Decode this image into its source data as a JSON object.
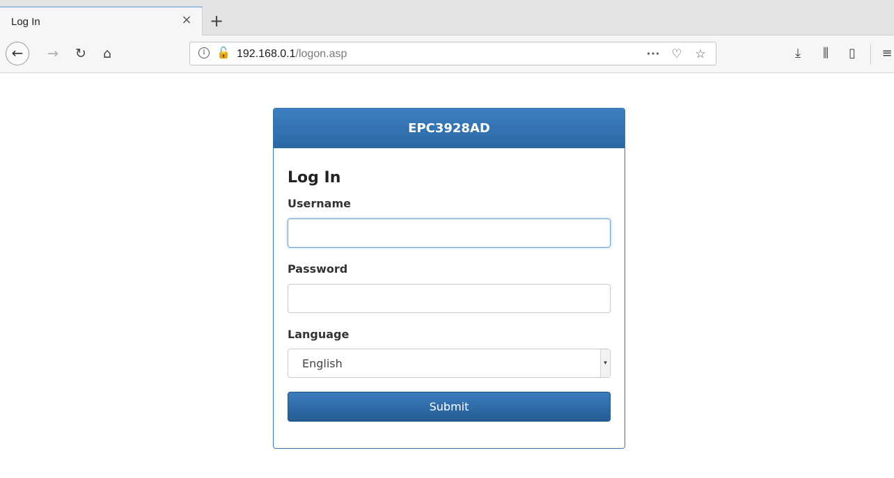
{
  "browser": {
    "tab": {
      "title": "Log In",
      "close_glyph": "×"
    },
    "new_tab_glyph": "+",
    "nav": {
      "back_glyph": "←",
      "forward_glyph": "→",
      "reload_glyph": "↻",
      "home_glyph": "⌂"
    },
    "url": {
      "host": "192.168.0.1",
      "path": "/logon.asp",
      "info_glyph": "i",
      "lock_glyph": "🔓"
    },
    "url_actions": {
      "more_glyph": "•••",
      "pocket_glyph": "♡",
      "bookmark_glyph": "☆"
    },
    "toolbar": {
      "download_glyph": "⤓",
      "library_glyph": "⫼",
      "sidebar_glyph": "▯",
      "menu_glyph": "≡"
    }
  },
  "login": {
    "header_title": "EPC3928AD",
    "form_title": "Log In",
    "username_label": "Username",
    "username_value": "",
    "password_label": "Password",
    "password_value": "",
    "language_label": "Language",
    "language_selected": "English",
    "select_arrow_glyph": "▾",
    "submit_label": "Submit"
  },
  "colors": {
    "header_blue": "#2f6fae",
    "focus_blue": "#66a3e0",
    "button_blue": "#2d6aa5"
  }
}
